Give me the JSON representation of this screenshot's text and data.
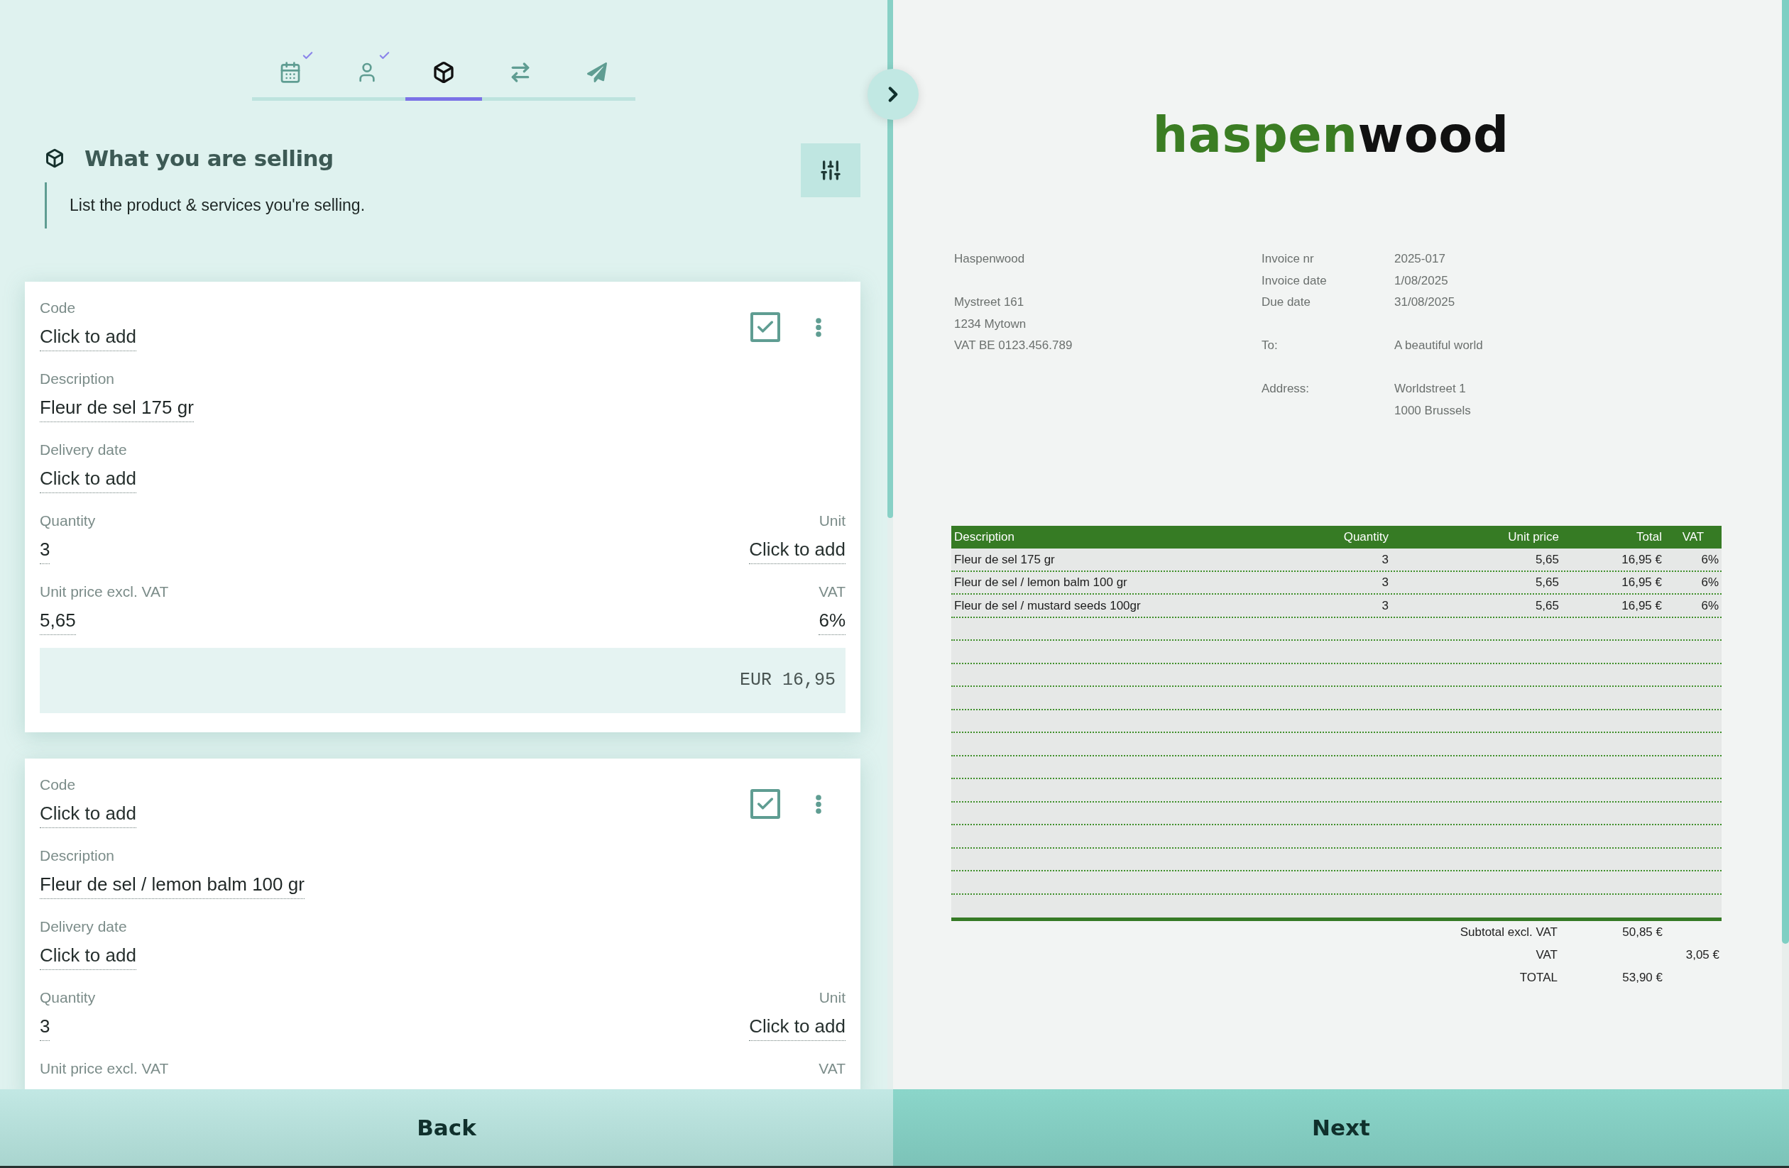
{
  "steps": [
    {
      "selected": false,
      "completed": true
    },
    {
      "selected": false,
      "completed": true
    },
    {
      "selected": true,
      "completed": false
    },
    {
      "selected": false,
      "completed": false
    },
    {
      "selected": false,
      "completed": false
    }
  ],
  "section": {
    "title": "What you are selling",
    "subtitle": "List the product & services you're selling."
  },
  "products": [
    {
      "checked": true,
      "rows": [
        [
          {
            "label": "Code",
            "placeholder": "Click to add"
          }
        ],
        [
          {
            "label": "Description",
            "value": "Fleur de sel 175 gr"
          }
        ],
        [
          {
            "label": "Delivery date",
            "placeholder": "Click to add"
          }
        ],
        [
          {
            "label": "Quantity",
            "value": "3"
          },
          {
            "label": "Unit",
            "placeholder": "Click to add"
          }
        ],
        [
          {
            "label": "Unit price excl. VAT",
            "value": "5,65"
          },
          {
            "label": "VAT",
            "value": "6%"
          }
        ]
      ],
      "total": "EUR 16,95"
    },
    {
      "checked": true,
      "rows": [
        [
          {
            "label": "Code",
            "placeholder": "Click to add"
          }
        ],
        [
          {
            "label": "Description",
            "value": "Fleur de sel / lemon balm 100 gr"
          }
        ],
        [
          {
            "label": "Delivery date",
            "placeholder": "Click to add"
          }
        ],
        [
          {
            "label": "Quantity",
            "value": "3"
          },
          {
            "label": "Unit",
            "placeholder": "Click to add"
          }
        ],
        [
          {
            "label": "Unit price excl. VAT"
          },
          {
            "label": "VAT"
          }
        ]
      ]
    }
  ],
  "invoice": {
    "logo": [
      "haspen",
      "wood"
    ],
    "sender": {
      "name": "Haspenwood",
      "lines": [
        "Mystreet 161",
        "1234 Mytown",
        "VAT BE 0123.456.789"
      ]
    },
    "meta": [
      {
        "label": "Invoice nr",
        "value": "2025-017"
      },
      {
        "label": "Invoice date",
        "value": "1/08/2025"
      },
      {
        "label": "Due date",
        "value": "31/08/2025"
      }
    ],
    "recipient": {
      "label": "To:",
      "value": "A beautiful world"
    },
    "address": {
      "label": "Address:",
      "lines": [
        "Worldstreet 1",
        "1000 Brussels"
      ]
    },
    "table": {
      "columns": [
        "Description",
        "Quantity",
        "Unit price",
        "Total",
        "VAT"
      ],
      "rows": [
        [
          "Fleur de sel 175 gr",
          "3",
          "5,65",
          "16,95 €",
          "6%"
        ],
        [
          "Fleur de sel / lemon balm 100 gr",
          "3",
          "5,65",
          "16,95 €",
          "6%"
        ],
        [
          "Fleur de sel / mustard seeds 100gr",
          "3",
          "5,65",
          "16,95 €",
          "6%"
        ]
      ]
    },
    "totals": [
      {
        "label": "Subtotal excl. VAT",
        "total": "50,85 €"
      },
      {
        "label": "VAT",
        "vat": "3,05 €"
      },
      {
        "label": "TOTAL",
        "total": "53,90 €"
      }
    ]
  },
  "buttons": {
    "back": "Back",
    "next": "Next"
  }
}
